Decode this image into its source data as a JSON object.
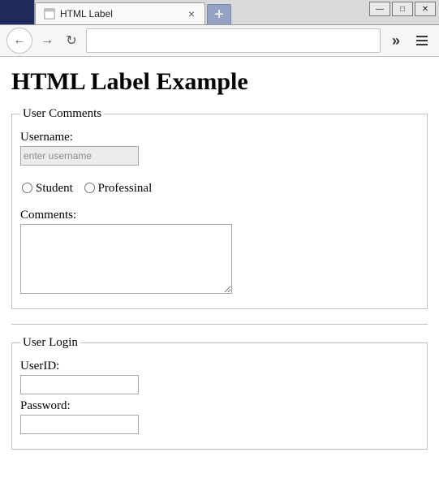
{
  "window": {
    "tab_title": "HTML Label",
    "min_glyph": "—",
    "max_glyph": "□",
    "close_glyph": "✕",
    "newtab_glyph": "+",
    "tabclose_glyph": "×",
    "back_glyph": "←",
    "fwd_glyph": "→",
    "reload_glyph": "↻",
    "overflow_glyph": "»"
  },
  "page": {
    "heading": "HTML Label Example",
    "comments": {
      "legend": "User Comments",
      "username_label": "Username:",
      "username_placeholder": "enter username",
      "radio_student": "Student",
      "radio_professional": "Professinal",
      "comments_label": "Comments:"
    },
    "login": {
      "legend": "User Login",
      "userid_label": "UserID:",
      "password_label": "Password:"
    }
  }
}
